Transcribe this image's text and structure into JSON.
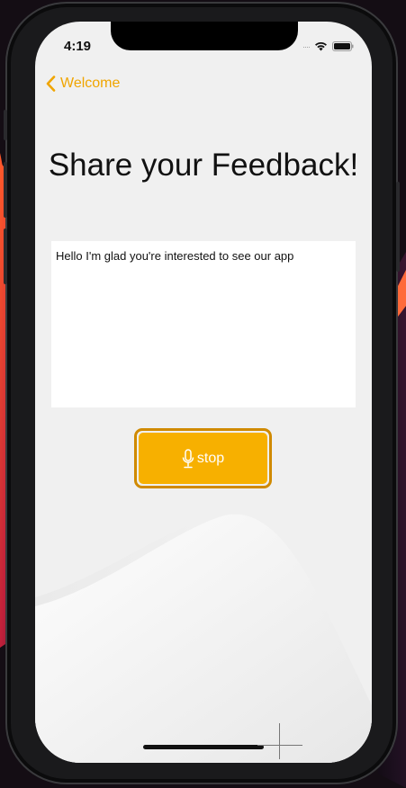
{
  "status_bar": {
    "time": "4:19",
    "icons": [
      "cellular-dots-icon",
      "wifi-icon",
      "battery-icon"
    ]
  },
  "nav": {
    "back_label": "Welcome",
    "back_icon": "chevron-left-icon"
  },
  "page": {
    "title": "Share your Feedback!"
  },
  "feedback": {
    "text": "Hello I'm glad you're interested to see our app"
  },
  "record_button": {
    "label": "stop",
    "icon": "microphone-icon"
  },
  "colors": {
    "accent": "#f7b000",
    "accent_border": "#d08a00",
    "back_link": "#f0a500",
    "screen_bg": "#f0f0f0",
    "textbox_bg": "#ffffff"
  }
}
